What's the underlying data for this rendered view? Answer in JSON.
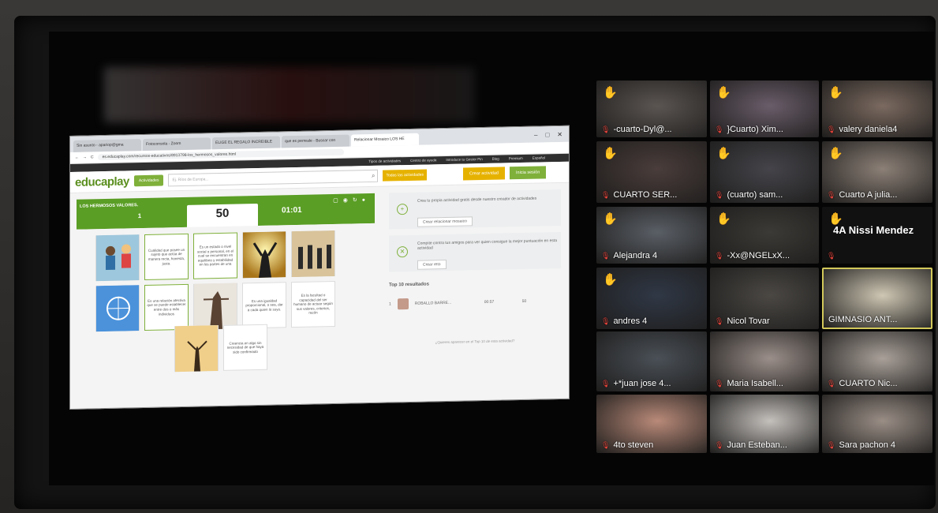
{
  "browser": {
    "tabs": [
      "Sin asunto - apariop@gma",
      "Fotoconsola - Zoom",
      "ELIGE EL REGALO INCREIBLE",
      "que es perreale - Buscar con",
      "Relacionar Mosaico LOS HE"
    ],
    "url": "es.educaplay.com/recursos-educativos/8913798-los_hermosos_valores.html",
    "top_links": [
      "Tipos de actividades",
      "Centro de ayuda",
      "Introduce tu Gestor Pin",
      "Blog",
      "Premium",
      "Español"
    ]
  },
  "educaplay": {
    "logo": "educaplay",
    "actividades_btn": "Actividades",
    "search_placeholder": "Ej. Ríos de Europa...",
    "todas_btn": "Todas las actividades",
    "crear_btn": "Crear actividad",
    "inicio_btn": "Inicia sesión"
  },
  "game": {
    "title": "LOS HERMOSOS VALORES.",
    "stat1": "1",
    "score": "50",
    "timer": "01:01",
    "cells": [
      "Cualidad que posee un sujeto que actúa de manera recta, honesta, justa.",
      "Es un estado o nivel social o personal, en el cual se encuentran en equilibrio y estabilidad en los partes de una",
      "Es una relación afectiva que se puede establecer entre dos o más individuos",
      "Es una igualdad proporcional, o sea, dar a cada quien lo suyo.",
      "Es la facultad o capacidad del ser humano de actuar según sus valores, criterios, razón",
      "Creencia en algo sin necesidad de que haya sido confirmado"
    ]
  },
  "side": {
    "cta1_text": "Crea tu propia actividad gratis desde nuestro creador de actividades",
    "cta1_btn": "Crear relacionar mosaico",
    "cta2_text": "Compite contra tus amigos para ver quien consigue la mejor puntuación en esta actividad",
    "cta2_btn": "Crear reto",
    "top10_title": "Top 10 resultados",
    "rank": {
      "pos": "1",
      "name": "ROBALLO BARRE...",
      "time": "00:57",
      "points": "50"
    },
    "footnote": "¿Quieres aparecer en el Top 10 de esta actividad?"
  },
  "participants": [
    {
      "name": "-cuarto-Dyl@...",
      "hand": true
    },
    {
      "name": "}Cuarto) Xim...",
      "hand": true
    },
    {
      "name": "valery daniela4",
      "hand": true
    },
    {
      "name": "CUARTO SER...",
      "hand": true
    },
    {
      "name": "(cuarto) sam...",
      "hand": true
    },
    {
      "name": "Cuarto A julia...",
      "hand": true
    },
    {
      "name": "Alejandra 4",
      "hand": true
    },
    {
      "name": "-Xx@NGELxX...",
      "hand": true
    },
    {
      "name": "4A Nissi Mendez",
      "hand": true
    },
    {
      "name": "andres 4",
      "hand": true
    },
    {
      "name": "Nicol Tovar",
      "hand": false
    },
    {
      "name": "GIMNASIO ANT...",
      "hand": false
    },
    {
      "name": "+*juan jose 4...",
      "hand": false
    },
    {
      "name": "Maria Isabell...",
      "hand": false
    },
    {
      "name": "CUARTO Nic...",
      "hand": false
    },
    {
      "name": "4to steven",
      "hand": false
    },
    {
      "name": "Juan Esteban...",
      "hand": false
    },
    {
      "name": "Sara pachon 4",
      "hand": false
    }
  ],
  "colors": {
    "green": "#5a9e25",
    "yellow": "#e6b200",
    "mic_red": "#e8453c"
  }
}
